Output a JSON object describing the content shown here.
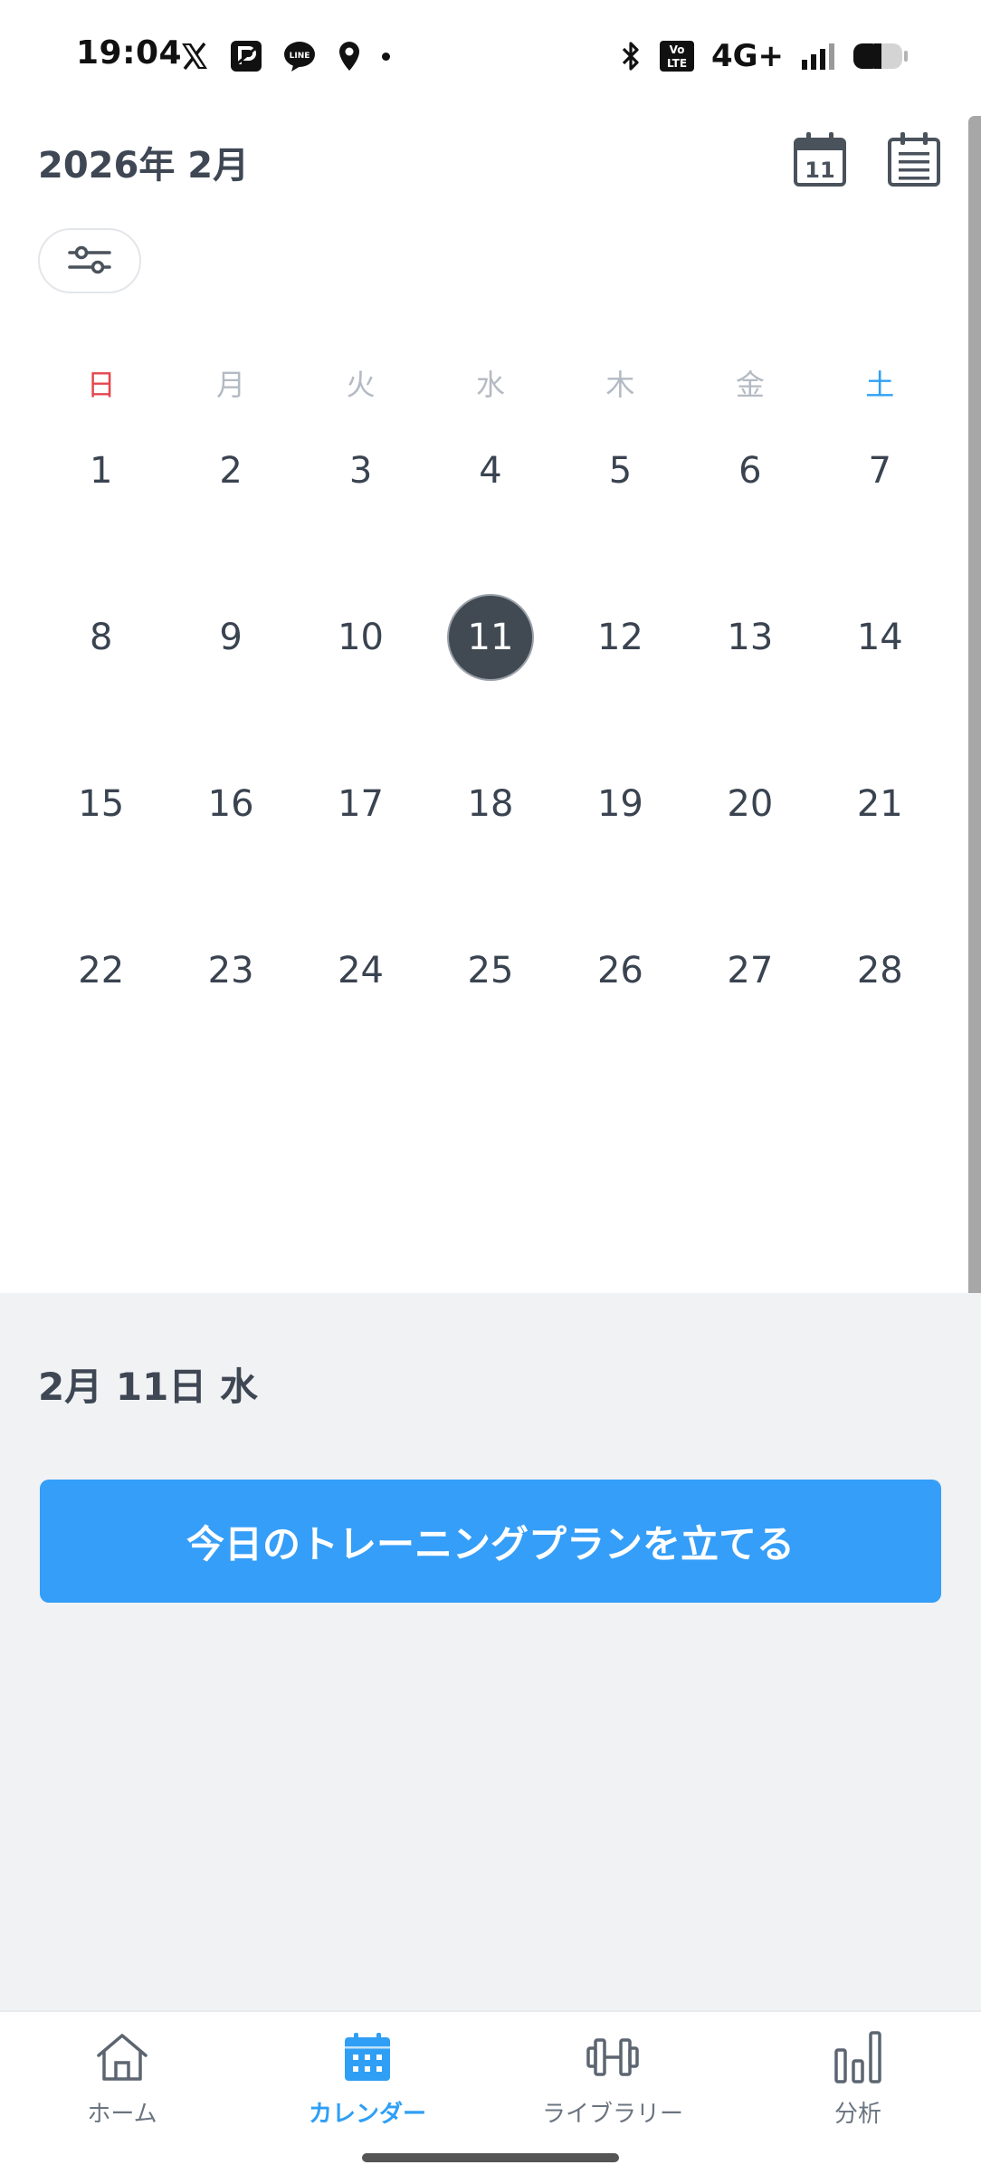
{
  "status_bar": {
    "time": "19:04",
    "network": "4G+",
    "left_icons": [
      "x-logo-icon",
      "paypay-icon",
      "line-icon",
      "location-icon",
      "dot-icon"
    ],
    "right_icons": [
      "bluetooth-icon",
      "volte-icon",
      "signal-icon",
      "battery-icon"
    ]
  },
  "header": {
    "month_title": "2026年 2月",
    "today_icon_number": "11"
  },
  "weekdays": [
    "日",
    "月",
    "火",
    "水",
    "木",
    "金",
    "土"
  ],
  "calendar": {
    "weeks": [
      [
        "1",
        "2",
        "3",
        "4",
        "5",
        "6",
        "7"
      ],
      [
        "8",
        "9",
        "10",
        "11",
        "12",
        "13",
        "14"
      ],
      [
        "15",
        "16",
        "17",
        "18",
        "19",
        "20",
        "21"
      ],
      [
        "22",
        "23",
        "24",
        "25",
        "26",
        "27",
        "28"
      ]
    ],
    "selected_day": "11"
  },
  "detail": {
    "date_label": "2月 11日 水",
    "plan_button": "今日のトレーニングプランを立てる"
  },
  "tabs": [
    {
      "label": "ホーム",
      "icon": "home-icon"
    },
    {
      "label": "カレンダー",
      "icon": "calendar-icon",
      "active": true
    },
    {
      "label": "ライブラリー",
      "icon": "dumbbell-icon"
    },
    {
      "label": "分析",
      "icon": "bar-chart-icon"
    }
  ],
  "colors": {
    "accent": "#359ef8",
    "sunday": "#e5474f",
    "saturday": "#2f9ff5",
    "selected_day": "#414952",
    "panel_bg": "#f1f2f4"
  }
}
